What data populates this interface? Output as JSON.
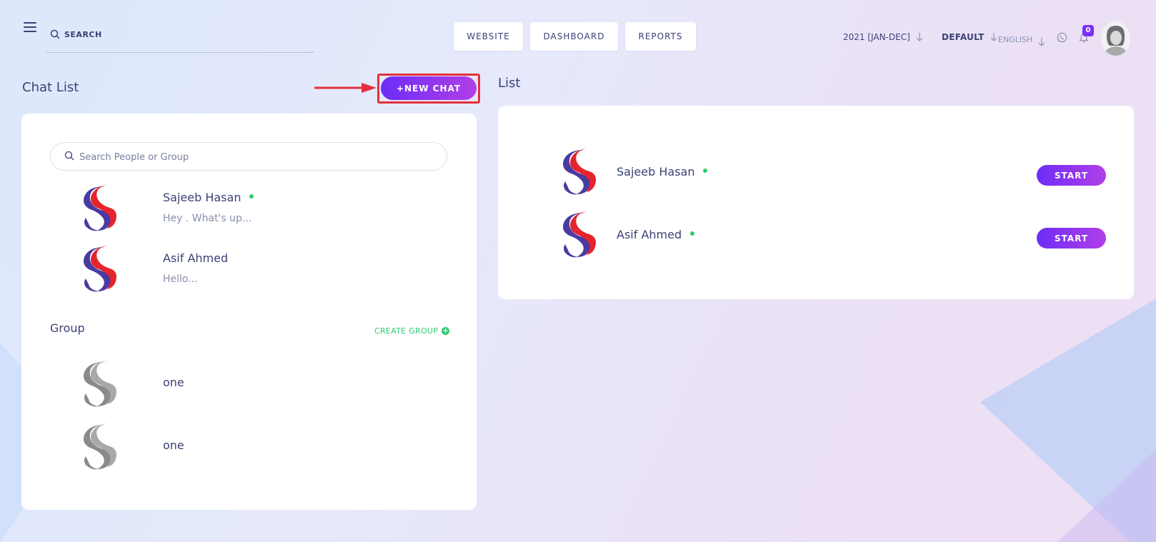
{
  "header": {
    "search_placeholder": "SEARCH",
    "nav": [
      "WEBSITE",
      "DASHBOARD",
      "REPORTS"
    ],
    "year_selector": "2021 [JAN-DEC]",
    "theme_selector": "DEFAULT",
    "language_selector": "ENGLISH",
    "notification_count": "0",
    "icons": [
      "menu-icon",
      "search-icon",
      "whatsapp-icon",
      "bell-icon",
      "arrow-down-icon"
    ]
  },
  "chat_list": {
    "title": "Chat List",
    "new_chat_label": "+NEW CHAT",
    "search_placeholder": "Search People or Group",
    "chats": [
      {
        "name": "Sajeeb Hasan",
        "message": "Hey . What's up...",
        "online": true
      },
      {
        "name": "Asif Ahmed",
        "message": "Hello...",
        "online": false
      }
    ],
    "group_title": "Group",
    "create_group_label": "CREATE GROUP",
    "groups": [
      {
        "name": "one"
      },
      {
        "name": "one"
      }
    ]
  },
  "list": {
    "title": "List",
    "start_label": "START",
    "people": [
      {
        "name": "Sajeeb Hasan",
        "online": true
      },
      {
        "name": "Asif Ahmed",
        "online": true
      }
    ]
  },
  "colors": {
    "accent_start": "#6d2cf6",
    "accent_end": "#b13fe8",
    "online": "#2ecc71",
    "text": "#3b4276",
    "callout": "#e4303b"
  }
}
